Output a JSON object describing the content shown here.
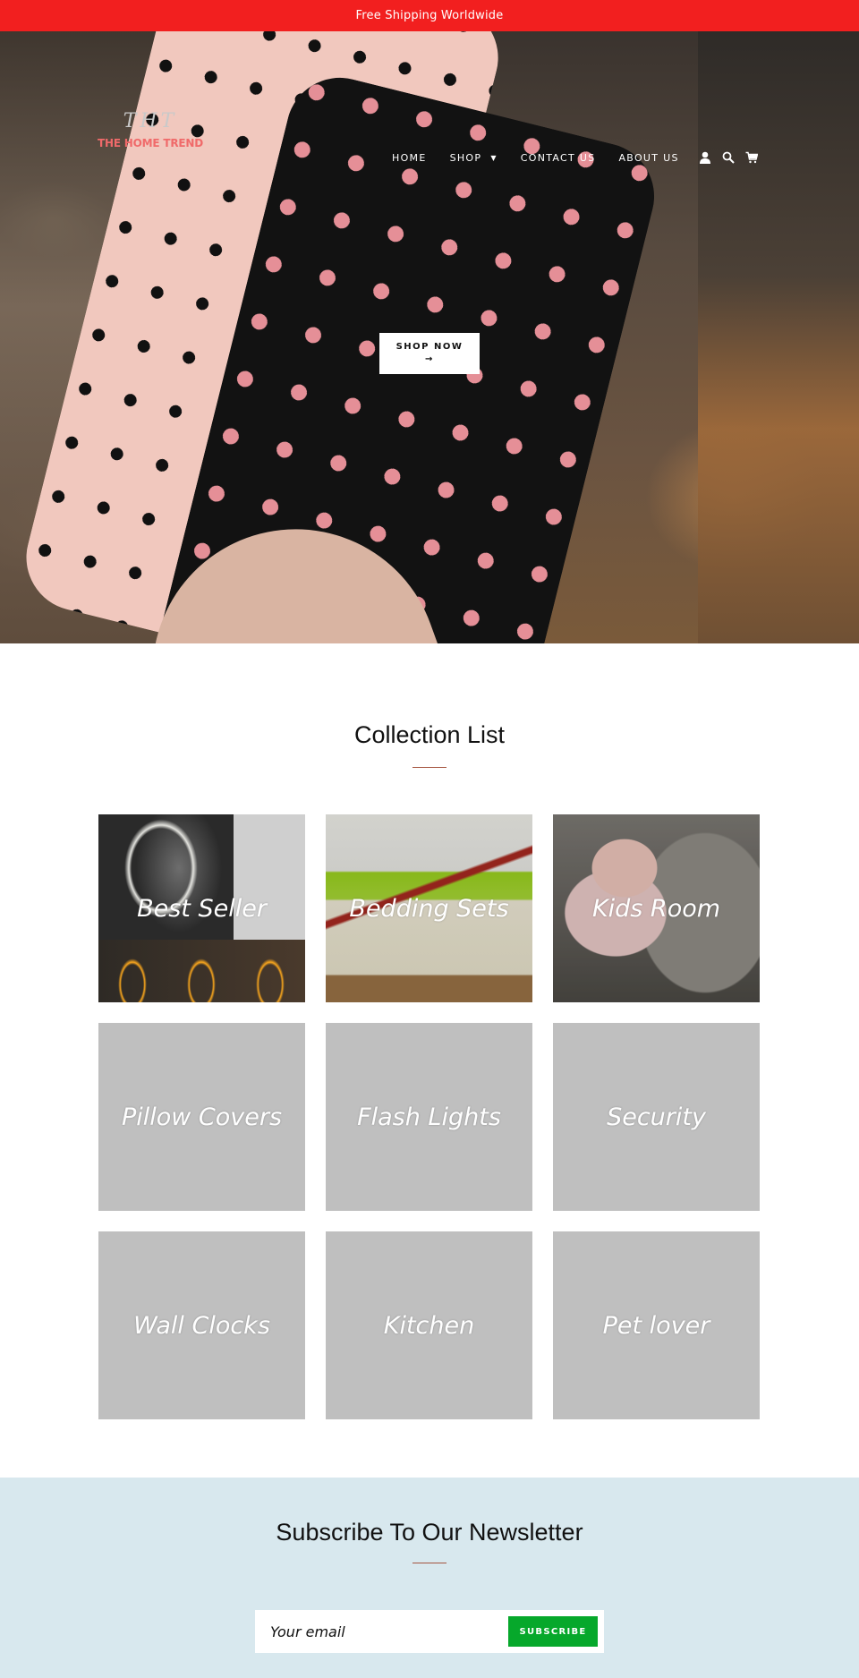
{
  "announcement": {
    "text": "Free Shipping Worldwide",
    "background_color": "#f21f1f"
  },
  "header": {
    "logo": {
      "monogram": "THT",
      "name": "THE HOME TREND",
      "name_color": "#f06a6a"
    },
    "nav": [
      {
        "label": "HOME",
        "has_dropdown": false
      },
      {
        "label": "SHOP",
        "has_dropdown": true
      },
      {
        "label": "CONTACT US",
        "has_dropdown": false
      },
      {
        "label": "ABOUT US",
        "has_dropdown": false
      }
    ],
    "icons": [
      "account-icon",
      "search-icon",
      "cart-icon"
    ]
  },
  "hero": {
    "button_label": "SHOP NOW",
    "button_arrow": "→",
    "slides_count": 6,
    "active_slide": 1
  },
  "collections": {
    "title": "Collection List",
    "items": [
      {
        "label": "Best Seller",
        "has_image": true
      },
      {
        "label": "Bedding Sets",
        "has_image": true
      },
      {
        "label": "Kids Room",
        "has_image": true
      },
      {
        "label": "Pillow Covers",
        "has_image": false
      },
      {
        "label": "Flash Lights",
        "has_image": false
      },
      {
        "label": "Security",
        "has_image": false
      },
      {
        "label": "Wall Clocks",
        "has_image": false
      },
      {
        "label": "Kitchen",
        "has_image": false
      },
      {
        "label": "Pet lover",
        "has_image": false
      }
    ],
    "accent_color": "#a4543f",
    "placeholder_color": "#bfbfbf"
  },
  "newsletter": {
    "title": "Subscribe To Our Newsletter",
    "email_placeholder": "Your email",
    "email_value": "",
    "button_label": "SUBSCRIBE",
    "button_color": "#06a82b",
    "background_color": "#d8e8ee"
  }
}
